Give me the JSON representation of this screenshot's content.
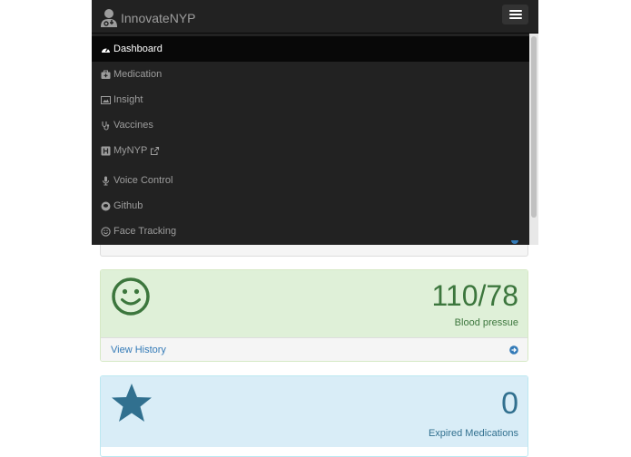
{
  "navbar": {
    "brand": "InnovateNYP",
    "brand_icon": "user-md-icon",
    "toggle_icon": "hamburger-icon"
  },
  "menu": {
    "items": [
      {
        "label": "Dashboard",
        "icon": "dashboard-icon",
        "active": true
      },
      {
        "label": "Medication",
        "icon": "medkit-icon",
        "active": false
      },
      {
        "label": "Insight",
        "icon": "picture-icon",
        "active": false
      },
      {
        "label": "Vaccines",
        "icon": "stethoscope-icon",
        "active": false
      },
      {
        "label": "MyNYP",
        "icon": "h-square-icon",
        "suffix_icon": "external-link-icon",
        "active": false
      },
      {
        "label": "Voice Control",
        "icon": "microphone-icon",
        "active": false
      },
      {
        "label": "Github",
        "icon": "github-icon",
        "active": false
      },
      {
        "label": "Face Tracking",
        "icon": "smile-icon",
        "active": false
      }
    ]
  },
  "panels": {
    "blood_pressure": {
      "value": "110/78",
      "label": "Blood pressue",
      "icon": "smile-icon",
      "footer": "View History",
      "footer_icon": "arrow-circle-right-icon"
    },
    "expired_medications": {
      "value": "0",
      "label": "Expired Medications",
      "icon": "star-icon"
    }
  },
  "colors": {
    "navbar_bg": "#222222",
    "active_bg": "#080808",
    "green_bg": "#dff0d8",
    "green_text": "#3c763d",
    "blue_bg": "#d9edf7",
    "blue_text": "#31708f",
    "link": "#337ab7"
  }
}
